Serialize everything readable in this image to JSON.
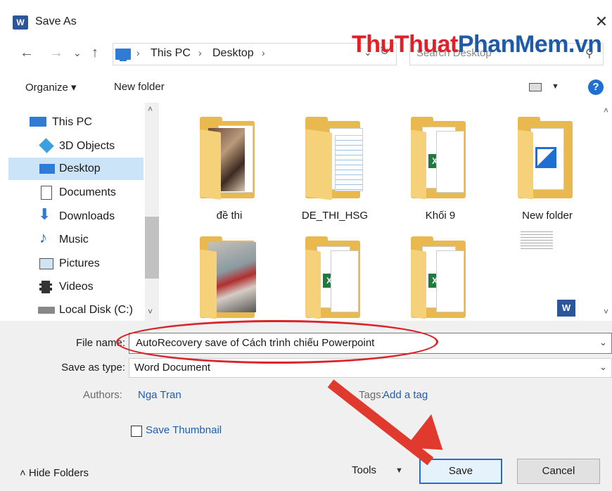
{
  "window": {
    "title": "Save As",
    "app_icon": "W",
    "close_symbol": "✕"
  },
  "watermark": {
    "part1": "ThuThuat",
    "part2": "PhanMem.vn"
  },
  "nav": {
    "back": "←",
    "forward": "→",
    "recent": "⌄",
    "up": "↑"
  },
  "address": {
    "crumbs": [
      "This PC",
      "Desktop"
    ],
    "sep": "›",
    "dropdown": "⌄",
    "refresh": "↻"
  },
  "search": {
    "placeholder": "Search Desktop",
    "icon": "⚲"
  },
  "toolbar": {
    "organize": "Organize ▾",
    "new_folder": "New folder",
    "view_drop": "▼",
    "help": "?"
  },
  "sidebar": {
    "items": [
      {
        "label": "This PC",
        "icon": "pc-icon"
      },
      {
        "label": "3D Objects",
        "icon": "cube-icon"
      },
      {
        "label": "Desktop",
        "icon": "desktop-icon",
        "selected": true
      },
      {
        "label": "Documents",
        "icon": "document-icon"
      },
      {
        "label": "Downloads",
        "icon": "download-icon"
      },
      {
        "label": "Music",
        "icon": "music-icon"
      },
      {
        "label": "Pictures",
        "icon": "picture-icon"
      },
      {
        "label": "Videos",
        "icon": "video-icon"
      },
      {
        "label": "Local Disk (C:)",
        "icon": "disk-icon"
      }
    ],
    "scroll_up": "˄",
    "scroll_down": "˅"
  },
  "files": [
    {
      "label": "đề thi",
      "kind": "photo-folder"
    },
    {
      "label": "DE_THI_HSG",
      "kind": "doc-folder"
    },
    {
      "label": "Khối 9",
      "kind": "xls-folder"
    },
    {
      "label": "New folder",
      "kind": "image-folder"
    },
    {
      "label": "",
      "kind": "photo-folder"
    },
    {
      "label": "",
      "kind": "xls-folder"
    },
    {
      "label": "",
      "kind": "xls-folder"
    },
    {
      "label": "",
      "kind": "word-file"
    }
  ],
  "file_scroll": {
    "up": "˄",
    "down": "˅"
  },
  "form": {
    "file_name_label": "File name:",
    "file_name_value": "AutoRecovery save of Cách trình chiếu Powerpoint",
    "save_type_label": "Save as type:",
    "save_type_value": "Word Document",
    "authors_label": "Authors:",
    "authors_value": "Nga Tran",
    "tags_label": "Tags:",
    "tags_value": "Add a tag",
    "save_thumbnail": "Save Thumbnail",
    "dropdown": "⌄"
  },
  "footer": {
    "hide_folders": "˄  Hide Folders",
    "tools": "Tools",
    "tools_drop": "▼",
    "save": "Save",
    "cancel": "Cancel"
  },
  "colors": {
    "accent": "#1e6fd0",
    "annotation": "#d8242a",
    "selected": "#cce4f7"
  }
}
